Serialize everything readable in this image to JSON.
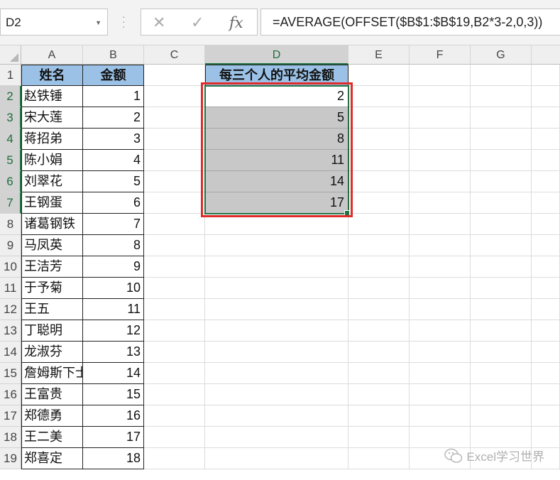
{
  "formula_bar": {
    "name_box": "D2",
    "cancel_icon": "✕",
    "enter_icon": "✓",
    "fx_label": "fx",
    "formula": "=AVERAGE(OFFSET($B$1:$B$19,B2*3-2,0,3))"
  },
  "columns": [
    "A",
    "B",
    "C",
    "D",
    "E",
    "F",
    "G"
  ],
  "rows": [
    "1",
    "2",
    "3",
    "4",
    "5",
    "6",
    "7",
    "8",
    "9",
    "10",
    "11",
    "12",
    "13",
    "14",
    "15",
    "16",
    "17",
    "18",
    "19"
  ],
  "table": {
    "header_name": "姓名",
    "header_amount": "金额",
    "names": [
      "赵铁锤",
      "宋大莲",
      "蒋招弟",
      "陈小娟",
      "刘翠花",
      "王钢蛋",
      "诸葛钢铁",
      "马凤英",
      "王洁芳",
      "于予菊",
      "王五",
      "丁聪明",
      "龙淑芬",
      "詹姆斯下士",
      "王富贵",
      "郑德勇",
      "王二美",
      "郑喜定"
    ],
    "amounts": [
      "1",
      "2",
      "3",
      "4",
      "5",
      "6",
      "7",
      "8",
      "9",
      "10",
      "11",
      "12",
      "13",
      "14",
      "15",
      "16",
      "17",
      "18"
    ]
  },
  "result": {
    "header": "每三个人的平均金额",
    "values": [
      "2",
      "5",
      "8",
      "11",
      "14",
      "17"
    ]
  },
  "watermark": "Excel学习世界",
  "colors": {
    "accent": "#217346",
    "highlight": "#e12b2b",
    "header_fill": "#9bc2e6"
  }
}
